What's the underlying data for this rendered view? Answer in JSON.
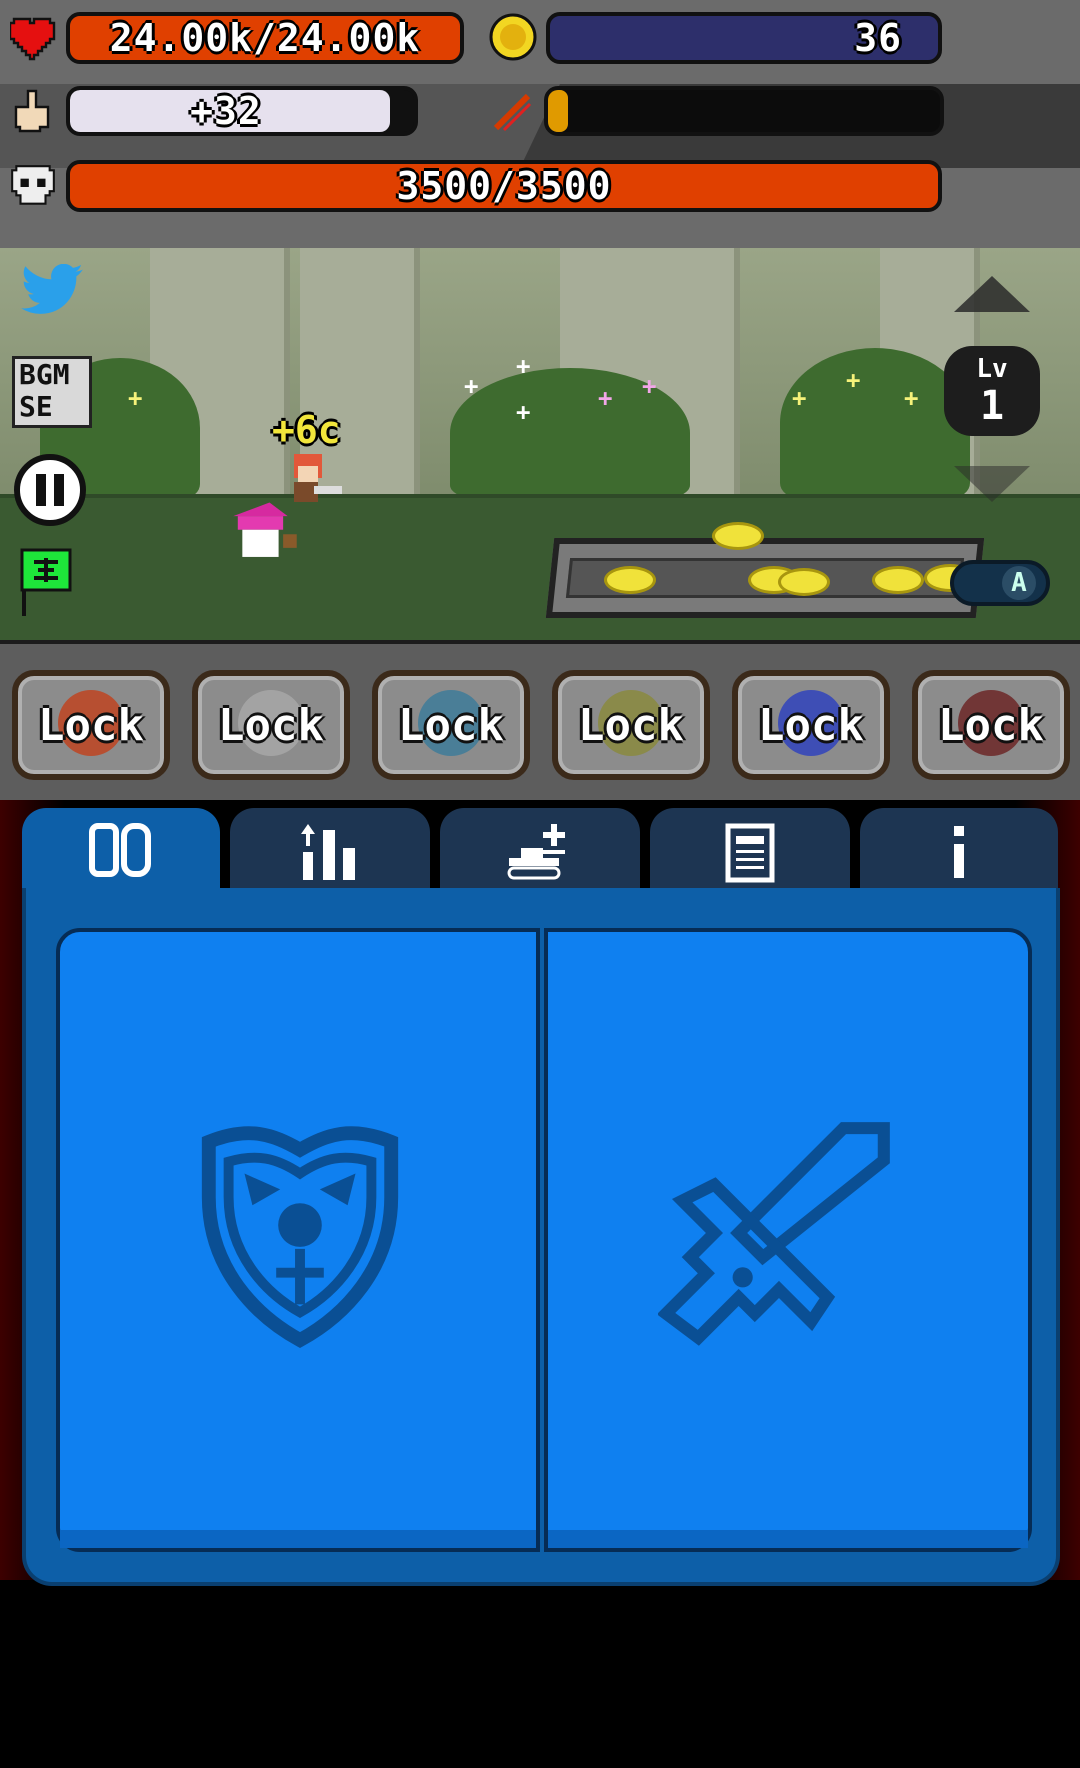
{
  "hud": {
    "hp_text": "24.00k/24.00k",
    "coins_text": "36",
    "tap_text": "+32",
    "enemy_hp_text": "3500/3500",
    "skill_charge_fraction": 0.05
  },
  "icons": {
    "hp": "heart-icon",
    "coin": "coin-icon",
    "tap": "pointing-hand-icon",
    "skill": "red-slash-icon",
    "enemy": "skull-icon",
    "twitter": "twitter-bird-icon",
    "pause": "pause-icon",
    "flag": "green-flag-icon"
  },
  "scene": {
    "sound_labels": [
      "BGM",
      "SE"
    ],
    "level_label": "Lv",
    "level_value": "1",
    "floating_reward": "+6c",
    "auto_badge": "A"
  },
  "skills": [
    {
      "label": "Lock",
      "art": "fire-claw"
    },
    {
      "label": "Lock",
      "art": "slime"
    },
    {
      "label": "Lock",
      "art": "crossed-swords"
    },
    {
      "label": "Lock",
      "art": "gold-coins"
    },
    {
      "label": "Lock",
      "art": "blue-potion"
    },
    {
      "label": "Lock",
      "art": "demon-jaw"
    }
  ],
  "tabs": [
    {
      "name": "cards",
      "active": true
    },
    {
      "name": "stats",
      "active": false
    },
    {
      "name": "tank-upgrade",
      "active": false
    },
    {
      "name": "log",
      "active": false
    },
    {
      "name": "info",
      "active": false
    }
  ],
  "panel": {
    "left_card": "shield-icon",
    "right_card": "sword-icon"
  },
  "colors": {
    "hp_bar": "#e04000",
    "coin_bar": "#2d2f6b",
    "tap_bar": "#e6e1ee",
    "skill_fill": "#e09a00",
    "panel": "#0d5fa8",
    "card": "#0f80f0"
  }
}
